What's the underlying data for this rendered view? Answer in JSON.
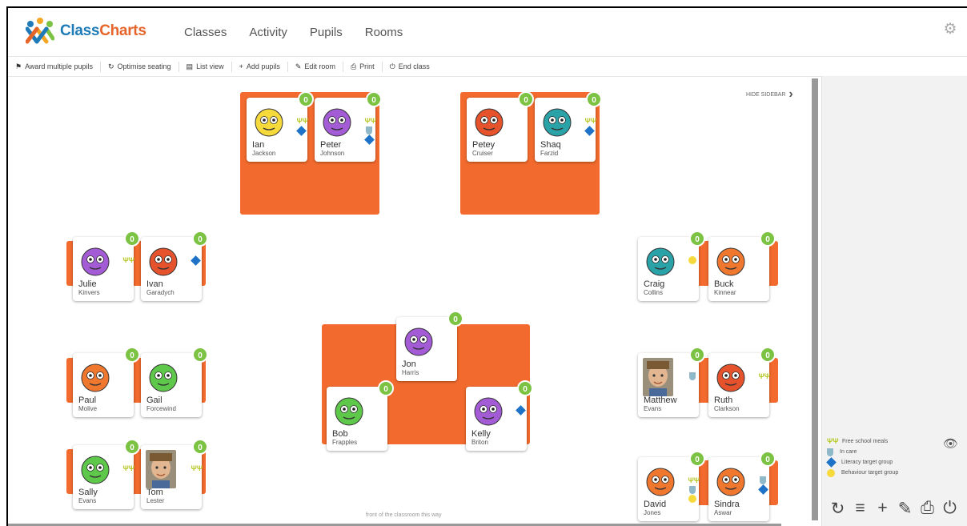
{
  "app": {
    "brand_part1": "Class",
    "brand_part2": "Charts"
  },
  "nav": {
    "items": [
      "Classes",
      "Activity",
      "Pupils",
      "Rooms"
    ]
  },
  "toolbar": {
    "items": [
      {
        "label": "Award multiple pupils",
        "icon": "flag-icon"
      },
      {
        "label": "Optimise seating",
        "icon": "refresh-icon"
      },
      {
        "label": "List view",
        "icon": "list-icon"
      },
      {
        "label": "Add pupils",
        "icon": "plus-icon"
      },
      {
        "label": "Edit room",
        "icon": "pencil-icon"
      },
      {
        "label": "Print",
        "icon": "print-icon"
      },
      {
        "label": "End class",
        "icon": "power-icon"
      }
    ]
  },
  "room": {
    "hide_sidebar_label": "HIDE SIDEBAR",
    "front_label": "front of the classroom this way"
  },
  "pupils": [
    {
      "first": "Ian",
      "last": "Jackson",
      "points": "0",
      "face": "yellow",
      "icons": [
        "meal",
        "literacy"
      ]
    },
    {
      "first": "Peter",
      "last": "Johnson",
      "points": "0",
      "face": "purple",
      "icons": [
        "meal",
        "care",
        "literacy"
      ]
    },
    {
      "first": "Petey",
      "last": "Cruiser",
      "points": "0",
      "face": "red",
      "icons": []
    },
    {
      "first": "Shaq",
      "last": "Farzid",
      "points": "0",
      "face": "teal",
      "icons": [
        "meal",
        "literacy"
      ]
    },
    {
      "first": "Julie",
      "last": "Kinvers",
      "points": "0",
      "face": "purple",
      "icons": [
        "meal"
      ]
    },
    {
      "first": "Ivan",
      "last": "Garadych",
      "points": "0",
      "face": "red",
      "icons": [
        "literacy"
      ]
    },
    {
      "first": "Craig",
      "last": "Collins",
      "points": "0",
      "face": "teal",
      "icons": [
        "behaviour"
      ]
    },
    {
      "first": "Buck",
      "last": "Kinnear",
      "points": "0",
      "face": "orange",
      "icons": []
    },
    {
      "first": "Jon",
      "last": "Harris",
      "points": "0",
      "face": "purple",
      "icons": []
    },
    {
      "first": "Paul",
      "last": "Molive",
      "points": "0",
      "face": "orange",
      "icons": []
    },
    {
      "first": "Gail",
      "last": "Forcewind",
      "points": "0",
      "face": "green",
      "icons": []
    },
    {
      "first": "Matthew",
      "last": "Evans",
      "points": "0",
      "face": "photo",
      "icons": [
        "care"
      ]
    },
    {
      "first": "Ruth",
      "last": "Clarkson",
      "points": "0",
      "face": "red",
      "icons": [
        "meal"
      ]
    },
    {
      "first": "Bob",
      "last": "Frapples",
      "points": "0",
      "face": "green",
      "icons": []
    },
    {
      "first": "Kelly",
      "last": "Briton",
      "points": "0",
      "face": "purple",
      "icons": [
        "literacy"
      ]
    },
    {
      "first": "Sally",
      "last": "Evans",
      "points": "0",
      "face": "green",
      "icons": [
        "meal"
      ]
    },
    {
      "first": "Tom",
      "last": "Lester",
      "points": "0",
      "face": "photo",
      "icons": [
        "meal"
      ]
    },
    {
      "first": "David",
      "last": "Jones",
      "points": "0",
      "face": "orange",
      "icons": [
        "meal",
        "care",
        "behaviour"
      ]
    },
    {
      "first": "Sindra",
      "last": "Aswar",
      "points": "0",
      "face": "orange",
      "icons": [
        "care",
        "literacy"
      ]
    }
  ],
  "legend": {
    "items": [
      {
        "label": "Free school meals",
        "icon": "meal"
      },
      {
        "label": "In care",
        "icon": "care"
      },
      {
        "label": "Literacy target group",
        "icon": "literacy"
      },
      {
        "label": "Behaviour target group",
        "icon": "behaviour"
      }
    ]
  },
  "sidebar_actions": [
    "refresh-icon",
    "list-icon",
    "plus-icon",
    "pencil-icon",
    "print-icon",
    "power-icon"
  ],
  "colors": {
    "table": "#f26a2d",
    "badge": "#7cc243",
    "brand_blue": "#1f7bb8",
    "brand_orange": "#e5652b"
  }
}
